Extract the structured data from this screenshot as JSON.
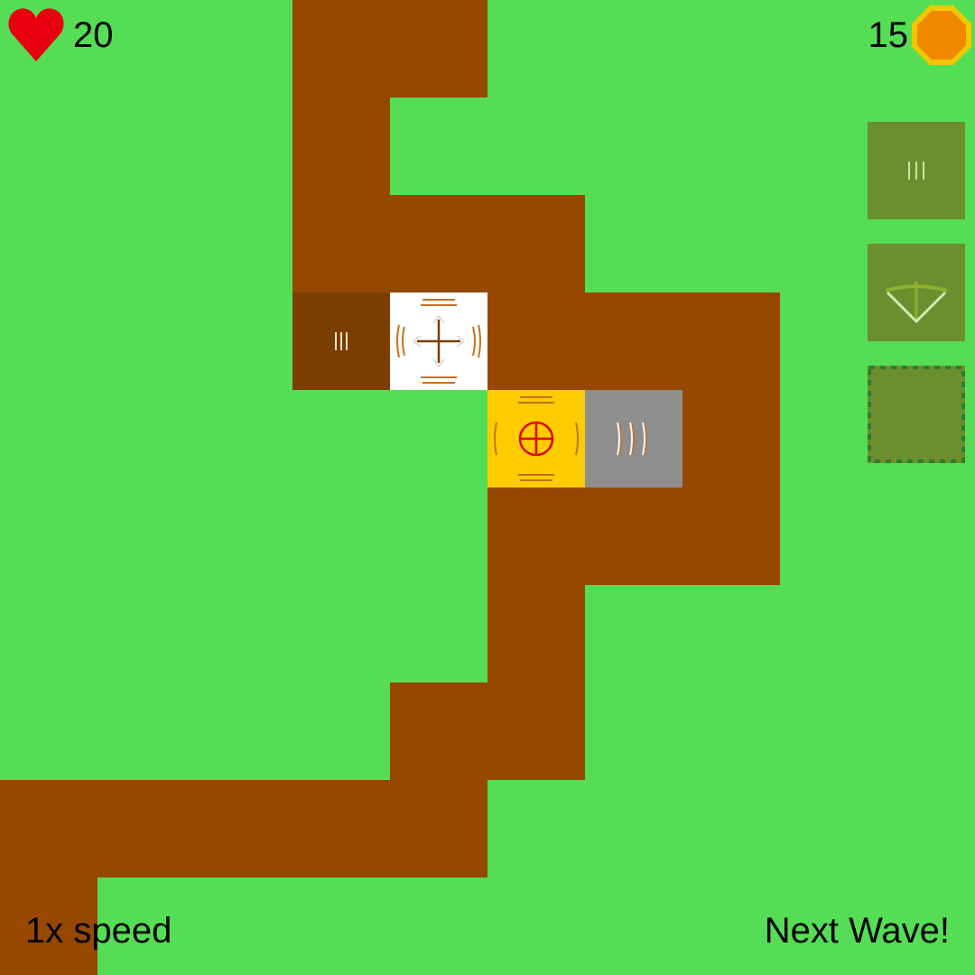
{
  "hud": {
    "lives": "20",
    "coins": "15",
    "lives_icon": "heart-icon",
    "coins_icon": "coin-icon"
  },
  "controls": {
    "speed_label": "1x speed",
    "next_wave_label": "Next Wave!"
  },
  "shop": {
    "items": [
      {
        "icon": "tower-ballista-icon"
      },
      {
        "icon": "tower-crossbow-icon"
      },
      {
        "icon": "empty-slot-icon"
      }
    ]
  },
  "colors": {
    "grass": "#55DE55",
    "path": "#964800",
    "shop_slot": "#6B8E2F",
    "heart": "#E8000F",
    "coin": "#F08800",
    "coin_rim": "#F0C800"
  }
}
